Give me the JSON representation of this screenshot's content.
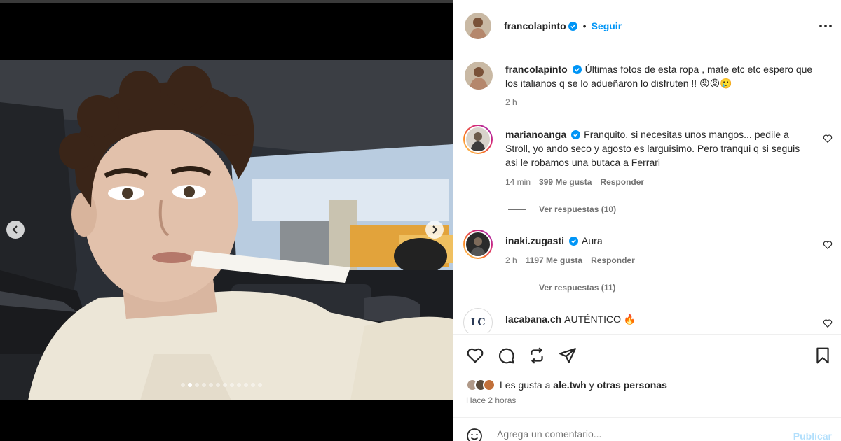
{
  "post": {
    "author": "francolapinto",
    "follow_label": "Seguir",
    "separator": "•",
    "caption": "Últimas fotos de esta ropa , mate etc etc espero que los italianos q se lo adueñaron lo disfruten !! 😡😡🥲",
    "caption_time": "2 h",
    "likes_prefix": "Les gusta a ",
    "likes_user": "ale.twh",
    "likes_middle": " y ",
    "likes_suffix": "otras personas",
    "time_ago": "Hace 2 horas"
  },
  "carousel": {
    "slide_count": 12,
    "active_index": 1
  },
  "comments": [
    {
      "user": "marianoanga",
      "text": "Franquito, si necesitas unos mangos... pedile a Stroll, yo ando seco y agosto es larguisimo. Pero tranqui q si seguis asi le robamos una butaca a Ferrari",
      "time": "14 min",
      "likes": "399 Me gusta",
      "reply": "Responder",
      "view_replies": "Ver respuestas (10)"
    },
    {
      "user": "inaki.zugasti",
      "text": "Aura",
      "time": "2 h",
      "likes": "1197 Me gusta",
      "reply": "Responder",
      "view_replies": "Ver respuestas (11)"
    },
    {
      "user": "lacabana.ch",
      "text": "AUTÉNTICO 🔥",
      "avatar_text": "LC"
    }
  ],
  "comment_input": {
    "placeholder": "Agrega un comentario...",
    "publish_label": "Publicar"
  },
  "colors": {
    "accent": "#0095f6",
    "publish_disabled": "#b2dffc",
    "muted": "#737373",
    "text": "#262626"
  }
}
